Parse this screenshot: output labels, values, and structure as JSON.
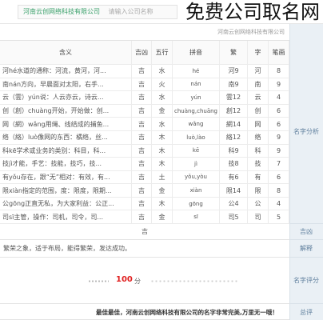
{
  "header": {
    "company_name": "河南云创网络科技有限公司",
    "search_placeholder": "请输入公司名称",
    "watermark": "免费公司取名网"
  },
  "subtitle": "河南云创网络科技有限公司",
  "table": {
    "section_label": "名字分析",
    "columns": [
      "含义",
      "吉凶",
      "五行",
      "拼音",
      "繁",
      "字",
      "笔画"
    ],
    "rows": [
      {
        "meaning": "河hé水道的通称：河流，黄河，河...",
        "luck": "吉",
        "element": "水",
        "pinyin": "hé",
        "trad": "河9",
        "char": "河",
        "strokes": "8"
      },
      {
        "meaning": "南nán方向，早晨面对太阳，右手...",
        "luck": "吉",
        "element": "火",
        "pinyin": "nán",
        "trad": "南9",
        "char": "南",
        "strokes": "9"
      },
      {
        "meaning": "云（雲）yún说：人云亦云，诗云...",
        "luck": "吉",
        "element": "水",
        "pinyin": "yún",
        "trad": "雲12",
        "char": "云",
        "strokes": "4"
      },
      {
        "meaning": "创（創）chuàng开始，开始做：创...",
        "luck": "吉",
        "element": "金",
        "pinyin": "chuàng,chuāng",
        "trad": "創12",
        "char": "创",
        "strokes": "6"
      },
      {
        "meaning": "网（網）wǎng用绳、线结成的捕鱼...",
        "luck": "吉",
        "element": "水",
        "pinyin": "wǎng",
        "trad": "網14",
        "char": "网",
        "strokes": "6"
      },
      {
        "meaning": "络（絡）luò像网的东西：橘络，丝...",
        "luck": "吉",
        "element": "木",
        "pinyin": "luò,lào",
        "trad": "絡12",
        "char": "络",
        "strokes": "9"
      },
      {
        "meaning": "科kē学术或业务的类别：科目，科...",
        "luck": "吉",
        "element": "木",
        "pinyin": "kē",
        "trad": "科9",
        "char": "科",
        "strokes": "9"
      },
      {
        "meaning": "技jì才能，手艺：技能，技巧，技...",
        "luck": "吉",
        "element": "木",
        "pinyin": "jì",
        "trad": "技8",
        "char": "技",
        "strokes": "7"
      },
      {
        "meaning": "有yǒu存在，跟“无”相对：有效，有...",
        "luck": "吉",
        "element": "土",
        "pinyin": "yǒu,yòu",
        "trad": "有6",
        "char": "有",
        "strokes": "6"
      },
      {
        "meaning": "限xiàn指定的范围，度：限度，限期...",
        "luck": "吉",
        "element": "金",
        "pinyin": "xiàn",
        "trad": "限14",
        "char": "限",
        "strokes": "8"
      },
      {
        "meaning": "公gōng正直无私，为大家利益：公正...",
        "luck": "吉",
        "element": "木",
        "pinyin": "gōng",
        "trad": "公4",
        "char": "公",
        "strokes": "4"
      },
      {
        "meaning": "司sī主管，操作：司机，司令，司...",
        "luck": "吉",
        "element": "金",
        "pinyin": "sī",
        "trad": "司5",
        "char": "司",
        "strokes": "5"
      }
    ]
  },
  "luck": {
    "label": "吉凶",
    "value": "吉"
  },
  "explanation": {
    "label": "解释",
    "value": "繁荣之象，适于布局，能得繁荣，发达成功。"
  },
  "score": {
    "label": "名字评分",
    "value": "100",
    "unit": "分"
  },
  "summary": {
    "label": "总评",
    "value": "最佳最佳，河南云创网络科技有限公司的名字非常完美,万里无一哦！"
  },
  "theme": {
    "score_color": "#e02020",
    "company_color": "#3aa06a",
    "label_color": "#5f7f9d"
  }
}
